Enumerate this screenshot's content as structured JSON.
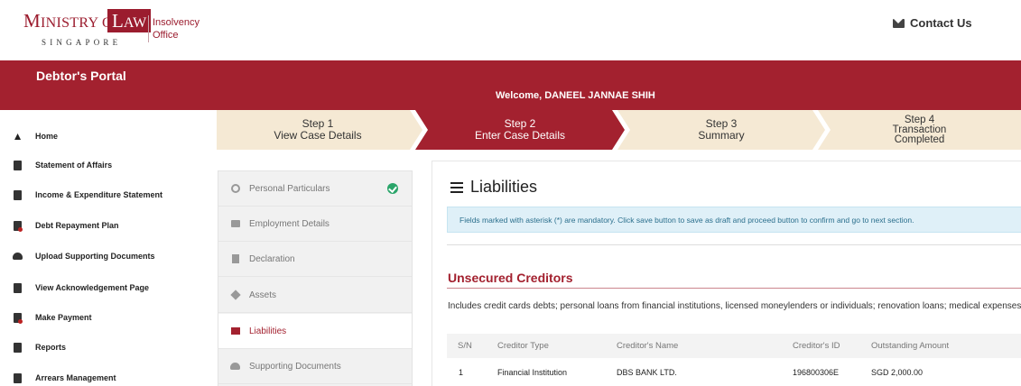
{
  "header": {
    "logo_ministry": "Ministry of",
    "logo_law": "Law",
    "logo_singapore": "SINGAPORE",
    "logo_insolvency": "Insolvency",
    "logo_office": "Office",
    "contact_label": "Contact Us"
  },
  "banner": {
    "portal_title": "Debtor's Portal",
    "welcome": "Welcome, DANEEL JANNAE SHIH"
  },
  "sidebar": {
    "items": [
      {
        "label": "Home",
        "icon": "home-icon"
      },
      {
        "label": "Statement of Affairs",
        "icon": "document-icon"
      },
      {
        "label": "Income & Expenditure Statement",
        "icon": "calculator-icon"
      },
      {
        "label": "Debt Repayment Plan",
        "icon": "plan-icon"
      },
      {
        "label": "Upload Supporting Documents",
        "icon": "cloud-upload-icon"
      },
      {
        "label": "View Acknowledgement Page",
        "icon": "file-icon"
      },
      {
        "label": "Make Payment",
        "icon": "payment-icon"
      },
      {
        "label": "Reports",
        "icon": "report-icon"
      },
      {
        "label": "Arrears Management",
        "icon": "arrears-icon"
      }
    ]
  },
  "steps": [
    {
      "line1": "Step 1",
      "line2": "View Case Details",
      "line3": ""
    },
    {
      "line1": "Step 2",
      "line2": "Enter Case Details",
      "line3": ""
    },
    {
      "line1": "Step 3",
      "line2": "Summary",
      "line3": ""
    },
    {
      "line1": "Step 4",
      "line2": "Transaction",
      "line3": "Completed"
    }
  ],
  "sections": [
    {
      "label": "Personal Particulars",
      "completed": true
    },
    {
      "label": "Employment Details",
      "completed": false
    },
    {
      "label": "Declaration",
      "completed": false
    },
    {
      "label": "Assets",
      "completed": false
    },
    {
      "label": "Liabilities",
      "completed": false,
      "active": true
    },
    {
      "label": "Supporting Documents",
      "completed": false
    }
  ],
  "main": {
    "title": "Liabilities",
    "notice": "Fields marked with asterisk (*) are mandatory. Click save button to save as draft and proceed button to confirm and go to next section.",
    "section_title": "Unsecured Creditors",
    "description": "Includes credit cards debts; personal loans from financial institutions, licensed moneylenders or individuals; renovation loans; medical expenses.",
    "table": {
      "headers": [
        "S/N",
        "Creditor Type",
        "Creditor's Name",
        "Creditor's ID",
        "Outstanding Amount"
      ],
      "rows": [
        [
          "1",
          "Financial Institution",
          "DBS BANK LTD.",
          "196800306E",
          "SGD 2,000.00"
        ]
      ]
    }
  },
  "colors": {
    "brand_red": "#a3212f",
    "step_active": "#a3212f",
    "step_inactive": "#f5e9d4",
    "success_green": "#2aa56a",
    "notice_bg": "#dff0f8"
  }
}
